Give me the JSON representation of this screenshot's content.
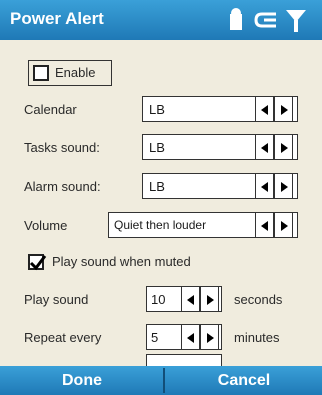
{
  "window": {
    "title": "Power Alert",
    "status_icons": [
      "battery-icon",
      "speaker-icon",
      "antenna-signal-icon"
    ]
  },
  "form": {
    "enable": {
      "label": "Enable",
      "checked": false
    },
    "calendar": {
      "label": "Calendar",
      "value": "LB"
    },
    "tasks_sound": {
      "label": "Tasks sound:",
      "value": "LB"
    },
    "alarm_sound": {
      "label": "Alarm sound:",
      "value": "LB"
    },
    "volume": {
      "label": "Volume",
      "value": "Quiet then louder"
    },
    "play_when_muted": {
      "label": "Play sound when muted",
      "checked": true
    },
    "play_sound": {
      "label": "Play sound",
      "value": "10",
      "unit": "seconds"
    },
    "repeat_every": {
      "label": "Repeat every",
      "value": "5",
      "unit": "minutes"
    }
  },
  "softkeys": {
    "left": "Done",
    "right": "Cancel"
  },
  "colors": {
    "bar": "#2a8cc7",
    "content_bg": "#f0ecde"
  }
}
